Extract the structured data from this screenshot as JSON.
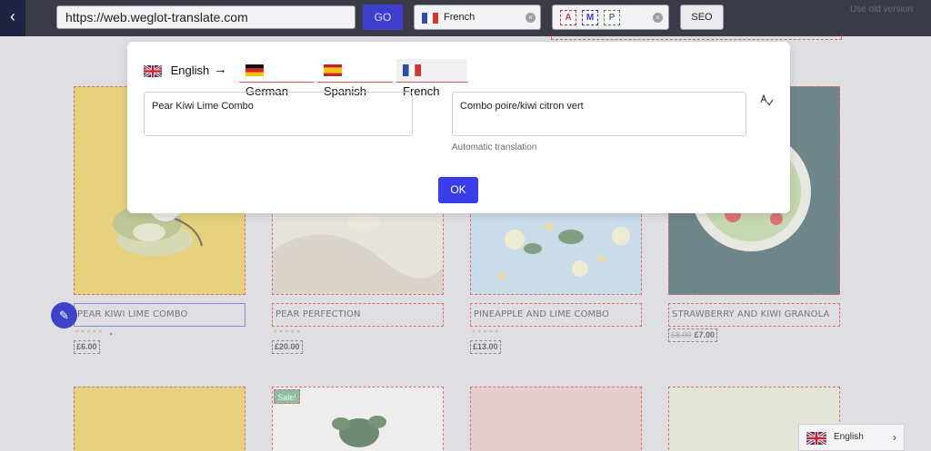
{
  "toolbar": {
    "back_icon": "chevron-left-icon",
    "url_value": "https://web.weglot-translate.com",
    "go_label": "GO",
    "language_selected": "French",
    "amp_tags": [
      "A",
      "M",
      "P"
    ],
    "seo_label": "SEO",
    "old_version_link": "Use old version"
  },
  "products": [
    {
      "title": "PEAR KIWI LIME COMBO",
      "price": "£6.00",
      "old_price": "",
      "stars": "★★★★★",
      "image_color": "#e6c845"
    },
    {
      "title": "PEAR PERFECTION",
      "price": "£20.00",
      "old_price": "",
      "stars": "★★★★★",
      "image_color": "#e7e0d6"
    },
    {
      "title": "PINEAPPLE AND LIME COMBO",
      "price": "£13.00",
      "old_price": "",
      "stars": "★★★★★",
      "image_color": "#bcd6ea"
    },
    {
      "title": "STRAWBERRY AND KIWI GRANOLA",
      "price": "£7.00",
      "old_price": "£8.00",
      "stars": "",
      "image_color": "#2f5258"
    }
  ],
  "second_row_colors": [
    "#e7c84a",
    "#f2f2f0",
    "#e6c2c4",
    "#e2e7cc"
  ],
  "sale_badge": "Sale!",
  "modal": {
    "source_language": "English",
    "arrow": "→",
    "target_languages": [
      "German",
      "Spanish",
      "French"
    ],
    "active_target": "French",
    "original_text": "Pear Kiwi Lime Combo",
    "translated_text": "Combo poire/kiwi citron vert",
    "auto_label": "Automatic translation",
    "ok_label": "OK"
  },
  "language_switcher": {
    "label": "English"
  },
  "colors": {
    "accent": "#3a3ee8",
    "dashed_outline": "#d6302f",
    "toolbar_bg": "#3b3b47"
  }
}
